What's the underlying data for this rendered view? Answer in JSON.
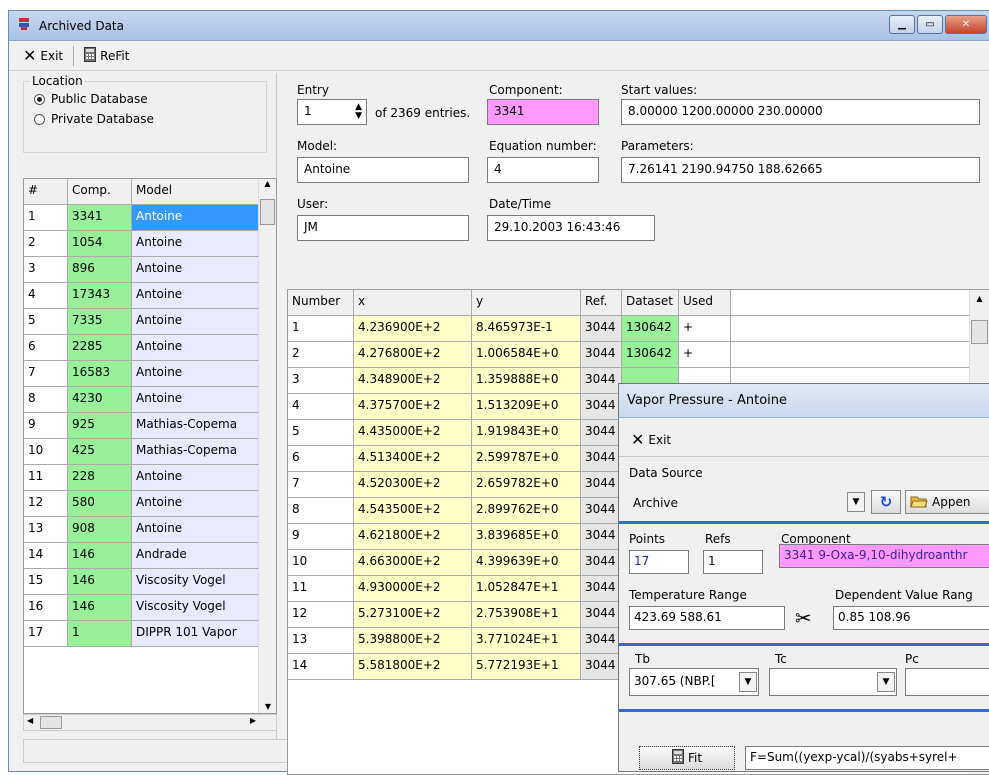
{
  "window": {
    "title": "Archived Data"
  },
  "toolbar": {
    "exit_label": "Exit",
    "refit_label": "ReFit"
  },
  "location": {
    "legend": "Location",
    "options": [
      "Public Database",
      "Private Database"
    ],
    "selected": 0
  },
  "left_table": {
    "headers": [
      "#",
      "Comp.",
      "Model"
    ],
    "rows": [
      [
        "1",
        "3341",
        "Antoine"
      ],
      [
        "2",
        "1054",
        "Antoine"
      ],
      [
        "3",
        "896",
        "Antoine"
      ],
      [
        "4",
        "17343",
        "Antoine"
      ],
      [
        "5",
        "7335",
        "Antoine"
      ],
      [
        "6",
        "2285",
        "Antoine"
      ],
      [
        "7",
        "16583",
        "Antoine"
      ],
      [
        "8",
        "4230",
        "Antoine"
      ],
      [
        "9",
        "925",
        "Mathias-Copema"
      ],
      [
        "10",
        "425",
        "Mathias-Copema"
      ],
      [
        "11",
        "228",
        "Antoine"
      ],
      [
        "12",
        "580",
        "Antoine"
      ],
      [
        "13",
        "908",
        "Antoine"
      ],
      [
        "14",
        "146",
        "Andrade"
      ],
      [
        "15",
        "146",
        "Viscosity Vogel"
      ],
      [
        "16",
        "146",
        "Viscosity Vogel"
      ],
      [
        "17",
        "1",
        "DIPPR 101 Vapor"
      ]
    ]
  },
  "entry": {
    "entry_label": "Entry",
    "entry_value": "1",
    "of_text": "of 2369 entries.",
    "component_label": "Component:",
    "component_value": "3341",
    "start_label": "Start values:",
    "start_value": "8.00000    1200.00000  230.00000",
    "model_label": "Model:",
    "model_value": "Antoine",
    "eq_label": "Equation number:",
    "eq_value": "4",
    "params_label": "Parameters:",
    "params_value": "7.26141    2190.94750  188.62665",
    "user_label": "User:",
    "user_value": "JM",
    "date_label": "Date/Time",
    "date_value": "29.10.2003 16:43:46"
  },
  "data_table": {
    "headers": [
      "Number",
      "x",
      "y",
      "Ref.",
      "Dataset",
      "Used"
    ],
    "rows": [
      [
        "1",
        "4.236900E+2",
        "8.465973E-1",
        "3044",
        "130642",
        "+"
      ],
      [
        "2",
        "4.276800E+2",
        "1.006584E+0",
        "3044",
        "130642",
        "+"
      ],
      [
        "3",
        "4.348900E+2",
        "1.359888E+0",
        "3044",
        "",
        ""
      ],
      [
        "4",
        "4.375700E+2",
        "1.513209E+0",
        "3044",
        "",
        ""
      ],
      [
        "5",
        "4.435000E+2",
        "1.919843E+0",
        "3044",
        "",
        ""
      ],
      [
        "6",
        "4.513400E+2",
        "2.599787E+0",
        "3044",
        "",
        ""
      ],
      [
        "7",
        "4.520300E+2",
        "2.659782E+0",
        "3044",
        "",
        ""
      ],
      [
        "8",
        "4.543500E+2",
        "2.899762E+0",
        "3044",
        "",
        ""
      ],
      [
        "9",
        "4.621800E+2",
        "3.839685E+0",
        "3044",
        "",
        ""
      ],
      [
        "10",
        "4.663000E+2",
        "4.399639E+0",
        "3044",
        "",
        ""
      ],
      [
        "11",
        "4.930000E+2",
        "1.052847E+1",
        "3044",
        "",
        ""
      ],
      [
        "12",
        "5.273100E+2",
        "2.753908E+1",
        "3044",
        "",
        ""
      ],
      [
        "13",
        "5.398800E+2",
        "3.771024E+1",
        "3044",
        "",
        ""
      ],
      [
        "14",
        "5.581800E+2",
        "5.772193E+1",
        "3044",
        "",
        ""
      ]
    ]
  },
  "popup": {
    "title": "Vapor Pressure - Antoine",
    "exit_label": "Exit",
    "data_source_label": "Data Source",
    "data_source_value": "Archive",
    "append_label": "Appen",
    "points_label": "Points",
    "points_value": "17",
    "refs_label": "Refs",
    "refs_value": "1",
    "component_label": "Component",
    "component_value": "3341 9-Oxa-9,10-dihydroanthr",
    "temp_label": "Temperature Range",
    "temp_value": "423.69 588.61",
    "dep_label": "Dependent Value Rang",
    "dep_value": "0.85  108.96",
    "tb_label": "Tb",
    "tc_label": "Tc",
    "pc_label": "Pc",
    "tb_value": "307.65 (NBP.[",
    "fit_label": "Fit",
    "formula": "F=Sum((yexp-ycal)/(syabs+syrel+"
  },
  "colors": {
    "component_field": "#ff99ff",
    "comp_column": "#98f098",
    "model_column": "#e9e9ff",
    "xy_column": "#ffffc8",
    "selected": "#3399ff"
  }
}
